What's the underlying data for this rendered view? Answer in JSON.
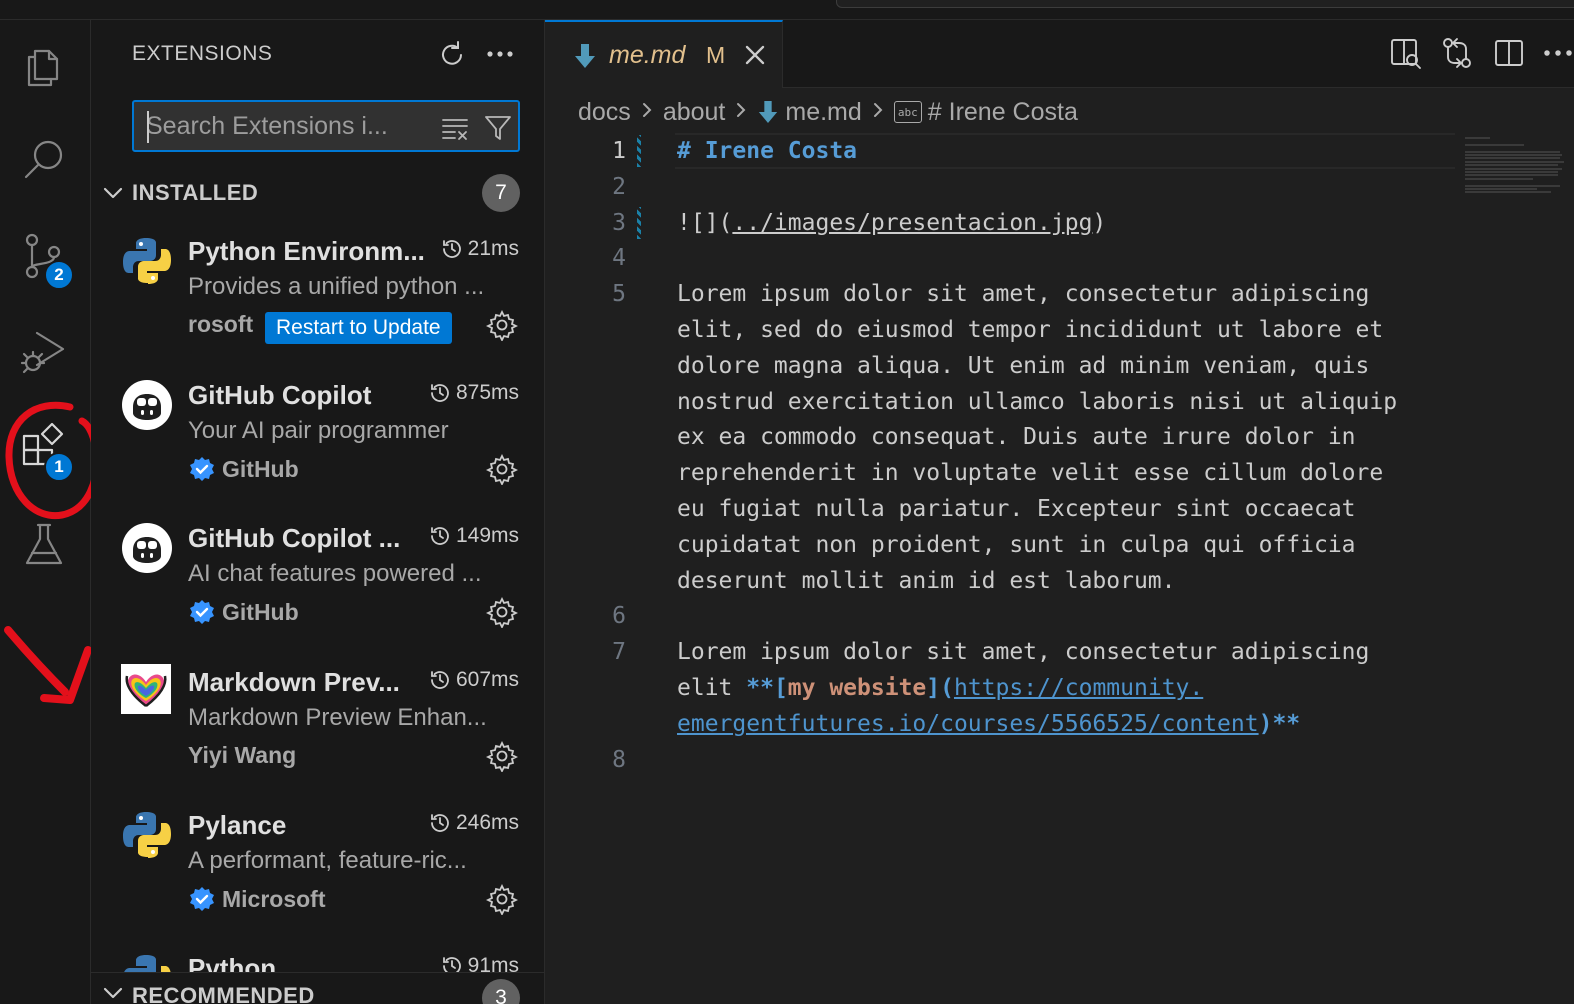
{
  "activity_bar": {
    "source_control_badge": "2",
    "extensions_badge": "1"
  },
  "sidebar": {
    "title": "EXTENSIONS",
    "search": {
      "placeholder": "Search Extensions i..."
    },
    "installed": {
      "label": "INSTALLED",
      "count": "7",
      "items": [
        {
          "name": "Python Environm...",
          "time": "21ms",
          "description": "Provides a unified python ...",
          "publisher": "rosoft",
          "verified": false,
          "action": "Restart to Update",
          "icon": "python-logo-icon"
        },
        {
          "name": "GitHub Copilot",
          "time": "875ms",
          "description": "Your AI pair programmer",
          "publisher": "GitHub",
          "verified": true,
          "icon": "copilot-logo-icon"
        },
        {
          "name": "GitHub Copilot ...",
          "time": "149ms",
          "description": "AI chat features powered ...",
          "publisher": "GitHub",
          "verified": true,
          "icon": "copilot-logo-icon"
        },
        {
          "name": "Markdown Prev...",
          "time": "607ms",
          "description": "Markdown Preview Enhan...",
          "publisher": "Yiyi Wang",
          "verified": false,
          "icon": "markdown-preview-logo-icon"
        },
        {
          "name": "Pylance",
          "time": "246ms",
          "description": "A performant, feature-ric...",
          "publisher": "Microsoft",
          "verified": true,
          "icon": "python-logo-icon"
        },
        {
          "name": "Python",
          "time": "91ms",
          "icon": "python-logo-icon"
        }
      ]
    },
    "recommended": {
      "label": "RECOMMENDED",
      "count": "3"
    }
  },
  "editor": {
    "tab": {
      "filename": "me.md",
      "modified": "M"
    },
    "breadcrumbs": [
      "docs",
      "about",
      "me.md",
      "# Irene Costa"
    ],
    "lines": [
      {
        "n": "1",
        "parts": [
          {
            "t": "# Irene Costa",
            "c": "tk-h"
          }
        ]
      },
      {
        "n": "2",
        "parts": []
      },
      {
        "n": "3",
        "parts": [
          {
            "t": "![](",
            "c": ""
          },
          {
            "t": "../images/presentacion.jpg",
            "c": "tk-link"
          },
          {
            "t": ")",
            "c": ""
          }
        ]
      },
      {
        "n": "4",
        "parts": []
      },
      {
        "n": "5",
        "parts": [
          {
            "t": "Lorem ipsum dolor sit amet, consectetur adipiscing",
            "c": ""
          }
        ]
      },
      {
        "n": "",
        "parts": [
          {
            "t": "elit, sed do eiusmod tempor incididunt ut labore et",
            "c": ""
          }
        ]
      },
      {
        "n": "",
        "parts": [
          {
            "t": "dolore magna aliqua. Ut enim ad minim veniam, quis",
            "c": ""
          }
        ]
      },
      {
        "n": "",
        "parts": [
          {
            "t": "nostrud exercitation ullamco laboris nisi ut aliquip",
            "c": ""
          }
        ]
      },
      {
        "n": "",
        "parts": [
          {
            "t": "ex ea commodo consequat. Duis aute irure dolor in",
            "c": ""
          }
        ]
      },
      {
        "n": "",
        "parts": [
          {
            "t": "reprehenderit in voluptate velit esse cillum dolore",
            "c": ""
          }
        ]
      },
      {
        "n": "",
        "parts": [
          {
            "t": "eu fugiat nulla pariatur. Excepteur sint occaecat",
            "c": ""
          }
        ]
      },
      {
        "n": "",
        "parts": [
          {
            "t": "cupidatat non proident, sunt in culpa qui officia",
            "c": ""
          }
        ]
      },
      {
        "n": "",
        "parts": [
          {
            "t": "deserunt mollit anim id est laborum.",
            "c": ""
          }
        ]
      },
      {
        "n": "6",
        "parts": []
      },
      {
        "n": "7",
        "parts": [
          {
            "t": "Lorem ipsum dolor sit amet, consectetur adipiscing",
            "c": ""
          }
        ]
      },
      {
        "n": "",
        "parts": [
          {
            "t": "elit ",
            "c": ""
          },
          {
            "t": "**[",
            "c": "tk-bold"
          },
          {
            "t": "my website",
            "c": "tk-lt"
          },
          {
            "t": "](",
            "c": "tk-bold"
          },
          {
            "t": "https://community.",
            "c": "tk-url"
          }
        ]
      },
      {
        "n": "",
        "parts": [
          {
            "t": "emergentfutures.io/courses/5566525/content",
            "c": "tk-url"
          },
          {
            "t": ")**",
            "c": "tk-bold"
          }
        ]
      },
      {
        "n": "8",
        "parts": []
      }
    ]
  },
  "colors": {
    "accent": "#0078d4",
    "annotation": "#e3101b",
    "modified": "#e2c08d"
  }
}
